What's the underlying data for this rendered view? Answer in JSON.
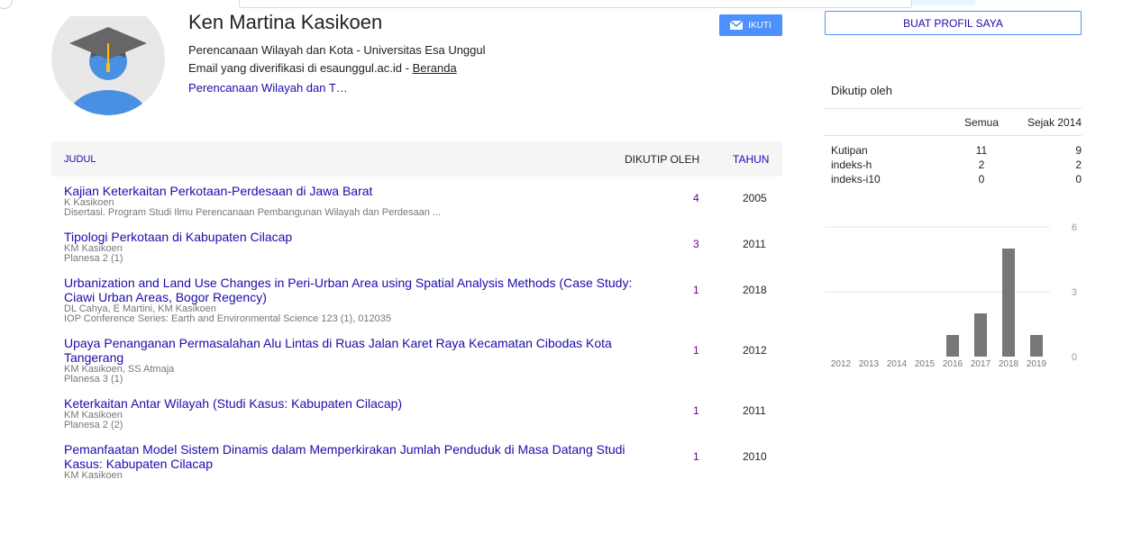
{
  "profile": {
    "name": "Ken Martina Kasikoen",
    "affiliation": "Perencanaan Wilayah dan Kota - Universitas Esa Unggul",
    "email_text": "Email yang diverifikasi di esaunggul.ac.id - ",
    "homepage_label": "Beranda",
    "interest": "Perencanaan Wilayah dan T…",
    "follow_label": "IKUTI",
    "avatar_icon": "graduate-avatar-icon",
    "follow_icon": "envelope-icon"
  },
  "table": {
    "col_title": "JUDUL",
    "col_cited": "DIKUTIP OLEH",
    "col_year": "TAHUN",
    "rows": [
      {
        "title": "Kajian Keterkaitan Perkotaan-Perdesaan di Jawa Barat",
        "authors": "K Kasikoen",
        "venue": "Disertasi. Program Studi Ilmu Perencanaan Pembangunan Wilayah dan Perdesaan ...",
        "cited": "4",
        "year": "2005"
      },
      {
        "title": "Tipologi Perkotaan di Kabupaten Cilacap",
        "authors": "KM Kasikoen",
        "venue": "Planesa 2 (1)",
        "cited": "3",
        "year": "2011"
      },
      {
        "title": "Urbanization and Land Use Changes in Peri-Urban Area using Spatial Analysis Methods (Case Study: Ciawi Urban Areas, Bogor Regency)",
        "authors": "DL Cahya, E Martini, KM Kasikoen",
        "venue": "IOP Conference Series: Earth and Environmental Science 123 (1), 012035",
        "cited": "1",
        "year": "2018"
      },
      {
        "title": "Upaya Penanganan Permasalahan Alu Lintas di Ruas Jalan Karet Raya Kecamatan Cibodas Kota Tangerang",
        "authors": "KM Kasikoen, SS Atmaja",
        "venue": "Planesa 3 (1)",
        "cited": "1",
        "year": "2012"
      },
      {
        "title": "Keterkaitan Antar Wilayah (Studi Kasus: Kabupaten Cilacap)",
        "authors": "KM Kasikoen",
        "venue": "Planesa 2 (2)",
        "cited": "1",
        "year": "2011"
      },
      {
        "title": "Pemanfaatan Model Sistem Dinamis dalam Memperkirakan Jumlah Penduduk di Masa Datang Studi Kasus: Kabupaten Cilacap",
        "authors": "KM Kasikoen",
        "venue": "",
        "cited": "1",
        "year": "2010"
      }
    ]
  },
  "sidebar": {
    "make_profile_label": "BUAT PROFIL SAYA",
    "cited_by_title": "Dikutip oleh",
    "col_all": "Semua",
    "col_since": "Sejak 2014",
    "metrics": [
      {
        "label": "Kutipan",
        "all": "11",
        "since": "9"
      },
      {
        "label": "indeks-h",
        "all": "2",
        "since": "2"
      },
      {
        "label": "indeks-i10",
        "all": "0",
        "since": "0"
      }
    ]
  },
  "chart_data": {
    "type": "bar",
    "categories": [
      "2012",
      "2013",
      "2014",
      "2015",
      "2016",
      "2017",
      "2018",
      "2019"
    ],
    "values": [
      0,
      0,
      0,
      0,
      1,
      2,
      5,
      1
    ],
    "ylim": [
      0,
      6
    ],
    "yticks": [
      "0",
      "3",
      "6"
    ],
    "bar_color": "#777777",
    "grid": true
  }
}
